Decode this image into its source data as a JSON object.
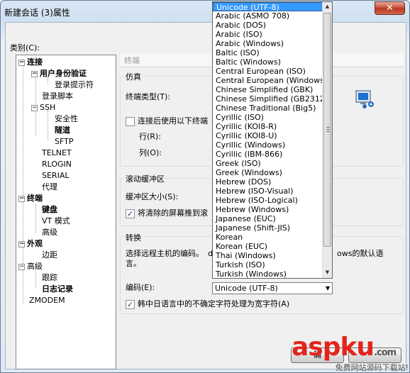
{
  "window": {
    "title": "新建会话 (3)属性",
    "close_label": "✕"
  },
  "category_label": "类别(C):",
  "tree": {
    "conn": "连接",
    "auth": "用户身份验证",
    "login_prompts": "登录提示符",
    "login_script": "登录脚本",
    "ssh": "SSH",
    "security": "安全性",
    "tunnel": "隧道",
    "sftp": "SFTP",
    "telnet": "TELNET",
    "rlogin": "RLOGIN",
    "serial": "SERIAL",
    "proxy": "代理",
    "terminal": "终端",
    "keyboard": "键盘",
    "vt_mode": "VT 模式",
    "advanced_t": "高级",
    "appearance": "外观",
    "margins": "边距",
    "advanced": "高级",
    "trace": "跟踪",
    "log": "日志记录",
    "zmodem": "ZMODEM",
    "toggle_minus": "−"
  },
  "panel": {
    "header": "终端",
    "emulation": {
      "title": "仿真",
      "terminal_type": "终端类型(T):",
      "use_after_connect": "连接后使用以下终端",
      "rows": "行(R):",
      "cols": "列(O):"
    },
    "scrollback": {
      "title": "滚动缓冲区",
      "buffer_size": "缓冲区大小(S):",
      "push_cleared": "将清除的屏幕推到滚"
    },
    "conversion": {
      "title": "转换",
      "desc_left": "选择远程主机的编码。",
      "desc_left_cut": "d",
      "desc_right": "ows的默认语",
      "desc_line2": "言。",
      "encoding_label": "编码(E):",
      "encoding_value": "Unicode (UTF-8)",
      "cjk_ambiguous": "韩中日语言中的不确定字符处理为宽字符(A)"
    }
  },
  "encoding_options": [
    "Unicode (UTF-8)",
    "Arabic (ASMO 708)",
    "Arabic (DOS)",
    "Arabic (ISO)",
    "Arabic (Windows)",
    "Baltic (ISO)",
    "Baltic (Windows)",
    "Central European (ISO)",
    "Central European (Windows)",
    "Chinese Simplified (GBK)",
    "Chinese Simplified (GB2312)",
    "Chinese Traditional (Big5)",
    "Cyrillic (ISO)",
    "Cyrillic (KOI8-R)",
    "Cyrillic (KOI8-U)",
    "Cyrillic (Windows)",
    "Cyrillic (IBM-866)",
    "Greek (ISO)",
    "Greek (Windows)",
    "Hebrew (DOS)",
    "Hebrew (ISO-Visual)",
    "Hebrew (ISO-Logical)",
    "Hebrew (Windows)",
    "Japanese (EUC)",
    "Japanese (Shift-JIS)",
    "Korean",
    "Korean (EUC)",
    "Thai (Windows)",
    "Turkish (ISO)",
    "Turkish (Windows)"
  ],
  "checks": {
    "mark": "✓"
  },
  "buttons": {
    "ok": "确",
    "cancel_partial": ""
  },
  "watermark": {
    "logo": "aspku",
    "logo_suffix": ".com",
    "subtitle": "免费网站源码下载站!"
  },
  "colors": {
    "selection": "#3399ff",
    "watermark": "#e2251c"
  }
}
